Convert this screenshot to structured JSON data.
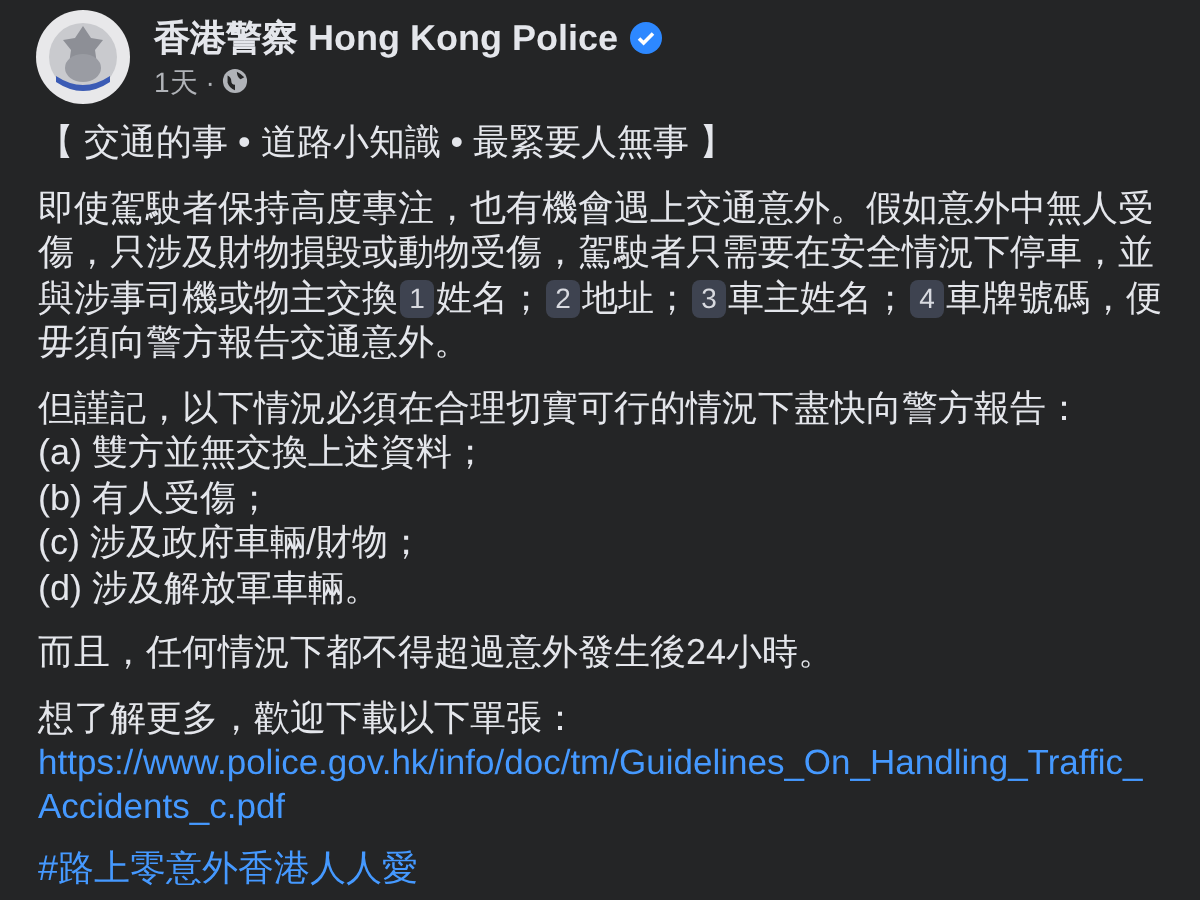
{
  "post": {
    "author": "香港警察 Hong Kong Police",
    "verified": true,
    "time": "1天",
    "separator": "·"
  },
  "body": [
    {
      "kind": "text",
      "text": "【 交通的事 • 道路小知識 • 最緊要人無事 】"
    },
    {
      "kind": "rich_text",
      "parts": [
        {
          "kind": "text",
          "text": "即使駕駛者保持高度專注，也有機會遇上交通意外。假如意外中無人受傷，只涉及財物損毀或動物受傷，駕駛者只需要在安全情況下停車，並與涉事司機或物主交換"
        },
        {
          "kind": "keycap",
          "text": "1"
        },
        {
          "kind": "text",
          "text": "姓名；"
        },
        {
          "kind": "keycap",
          "text": "2"
        },
        {
          "kind": "text",
          "text": "地址；"
        },
        {
          "kind": "keycap",
          "text": "3"
        },
        {
          "kind": "text",
          "text": "車主姓名；"
        },
        {
          "kind": "keycap",
          "text": "4"
        },
        {
          "kind": "text",
          "text": "車牌號碼，便毋須向警方報告交通意外。"
        }
      ]
    },
    {
      "kind": "lines",
      "lines": [
        "但謹記，以下情況必須在合理切實可行的情況下盡快向警方報告：",
        "(a) 雙方並無交換上述資料；",
        "(b) 有人受傷；",
        "(c) 涉及政府車輛/財物；",
        "(d) 涉及解放軍車輛。"
      ]
    },
    {
      "kind": "text",
      "text": "而且，任何情況下都不得超過意外發生後24小時。"
    },
    {
      "kind": "link_para",
      "text": "想了解更多，歡迎下載以下單張：",
      "link": "https://www.police.gov.hk/info/doc/tm/Guidelines_On_Handling_Traffic_Accidents_c.pdf"
    },
    {
      "kind": "hashtag",
      "text": "#路上零意外香港人人愛"
    }
  ]
}
